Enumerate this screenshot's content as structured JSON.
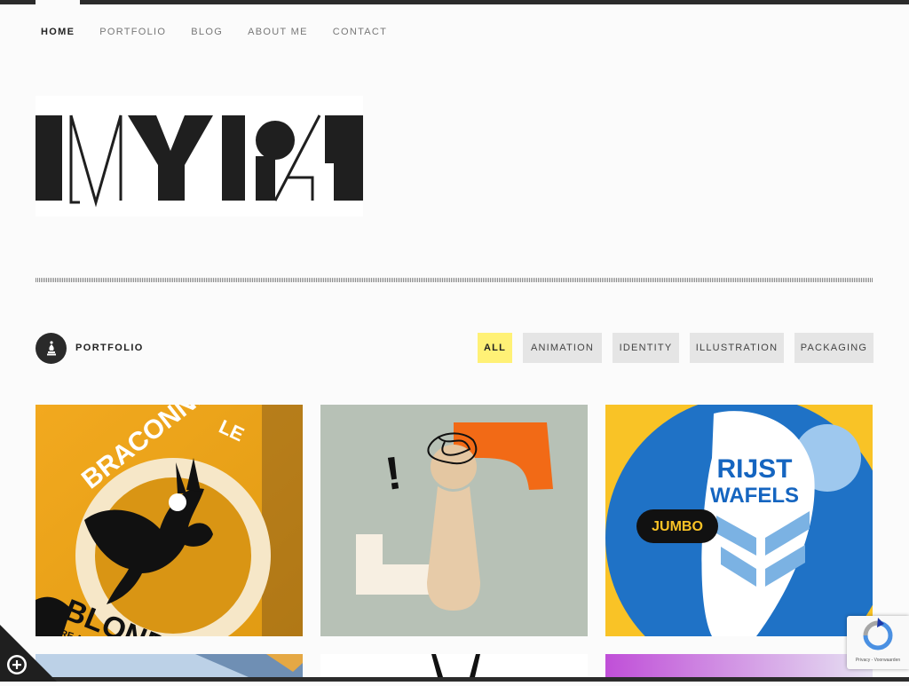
{
  "nav": {
    "items": [
      {
        "label": "HOME",
        "active": true
      },
      {
        "label": "PORTFOLIO"
      },
      {
        "label": "BLOG"
      },
      {
        "label": "ABOUT ME"
      },
      {
        "label": "CONTACT"
      }
    ]
  },
  "logo": {
    "text": "MYPA",
    "color": "#1f1f1f"
  },
  "section": {
    "icon": "bishop-icon",
    "title": "PORTFOLIO"
  },
  "filters": [
    {
      "label": "ALL",
      "active": true
    },
    {
      "label": "ANIMATION"
    },
    {
      "label": "IDENTITY"
    },
    {
      "label": "ILLUSTRATION"
    },
    {
      "label": "PACKAGING"
    }
  ],
  "portfolio": {
    "items": [
      {
        "name": "le-braconnier-blonde",
        "texts": [
          "LE",
          "BRACONNIER",
          "BLOND",
          "ÈRE ARTIS"
        ]
      },
      {
        "name": "wooden-figure-illustration",
        "texts": [
          "!"
        ]
      },
      {
        "name": "jumbo-rijst-wafels",
        "texts": [
          "RIJST",
          "WAFELS",
          "JUMBO"
        ]
      },
      {
        "name": "portfolio-item-4",
        "texts": []
      },
      {
        "name": "portfolio-item-5",
        "texts": []
      },
      {
        "name": "portfolio-item-6",
        "texts": []
      }
    ]
  },
  "widgets": {
    "corner_icon": "plus-circle-icon",
    "recaptcha_text": "Privacy - Voorwaarden"
  },
  "colors": {
    "active_filter": "#fff176",
    "filter_bg": "#e5e5e5",
    "dark": "#2b2b2b"
  }
}
